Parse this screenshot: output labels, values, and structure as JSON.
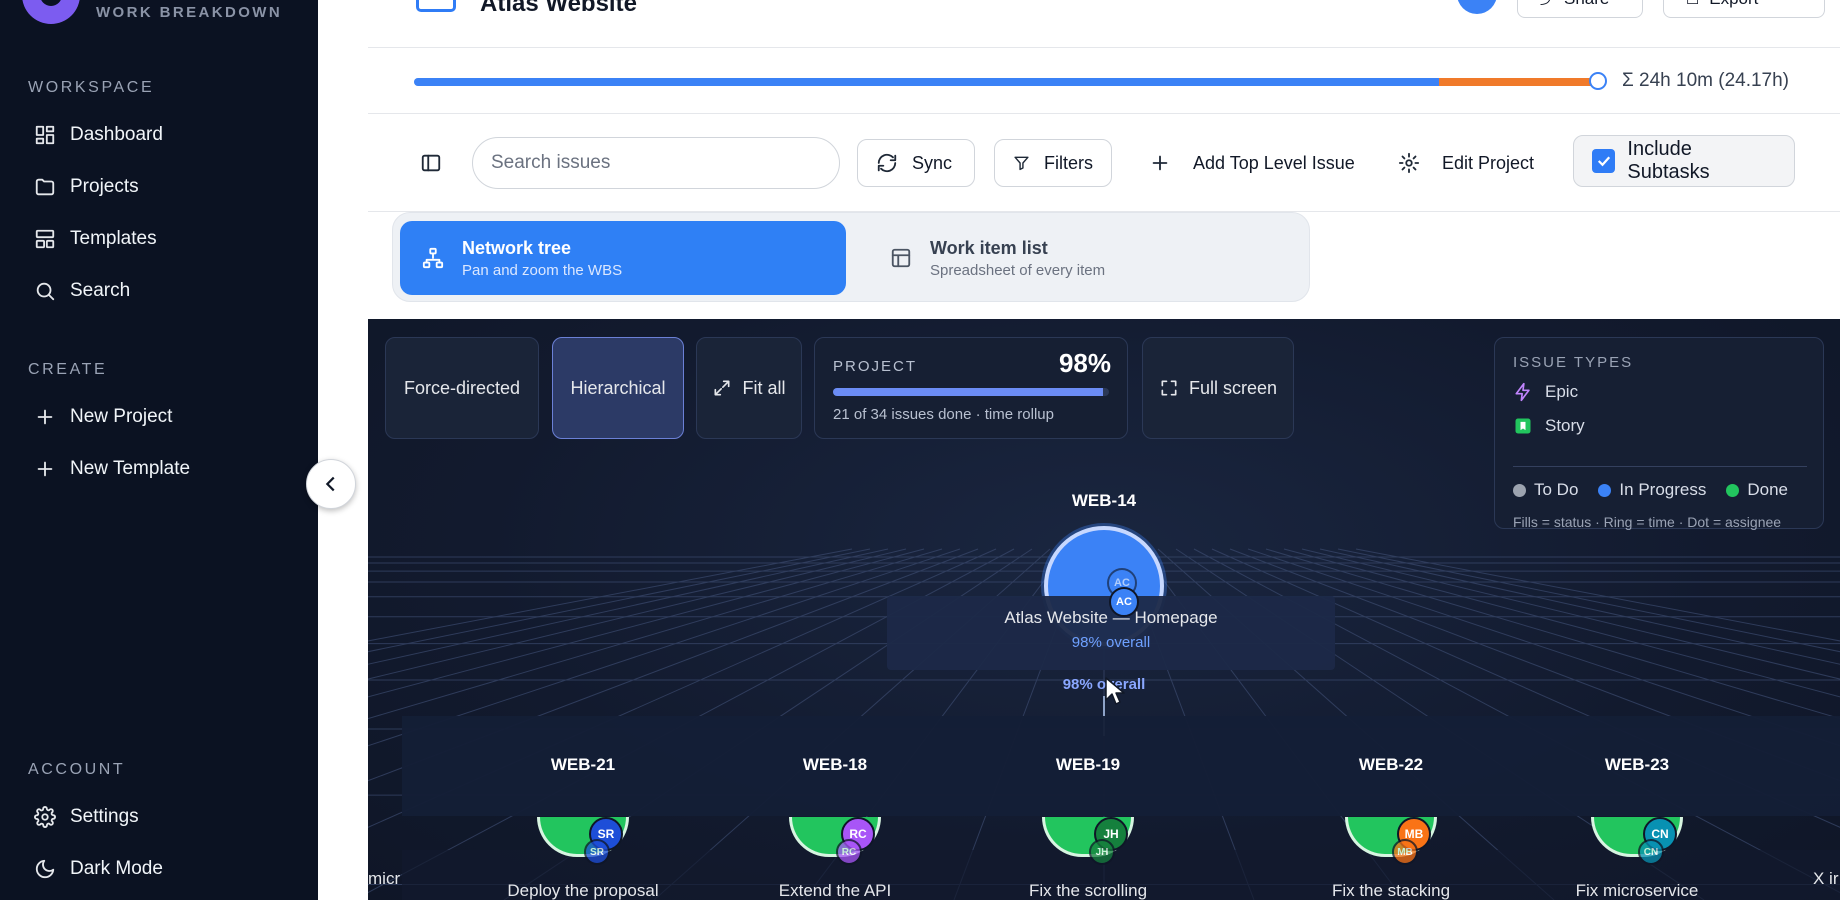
{
  "sidebar": {
    "brand_subtitle": "WORK BREAKDOWN",
    "workspace_label": "WORKSPACE",
    "workspace_items": [
      {
        "label": "Dashboard",
        "icon": "dashboard-icon"
      },
      {
        "label": "Projects",
        "icon": "folder-icon"
      },
      {
        "label": "Templates",
        "icon": "template-icon"
      },
      {
        "label": "Search",
        "icon": "search-icon"
      }
    ],
    "create_label": "CREATE",
    "create_items": [
      {
        "label": "New Project",
        "icon": "plus-icon"
      },
      {
        "label": "New Template",
        "icon": "plus-icon"
      }
    ],
    "account_label": "ACCOUNT",
    "account_items": [
      {
        "label": "Settings",
        "icon": "gear-icon"
      },
      {
        "label": "Dark Mode",
        "icon": "moon-icon"
      }
    ]
  },
  "header": {
    "project_title": "Atlas Website",
    "share_label": "Share",
    "export_label": "Export"
  },
  "progress": {
    "done_fraction": 0.866,
    "overrun_fraction": 0.134,
    "total_text": "Σ 24h 10m (24.17h)"
  },
  "toolbar": {
    "search_placeholder": "Search issues",
    "sync_label": "Sync",
    "filters_label": "Filters",
    "add_top_label": "Add Top Level Issue",
    "edit_project_label": "Edit Project",
    "include_subtasks_label": "Include Subtasks",
    "include_subtasks_checked": true
  },
  "views": {
    "network": {
      "title": "Network tree",
      "subtitle": "Pan and zoom the WBS"
    },
    "list": {
      "title": "Work item list",
      "subtitle": "Spreadsheet of every item"
    }
  },
  "canvas": {
    "layout_force": "Force-directed",
    "layout_hier": "Hierarchical",
    "fit_all": "Fit all",
    "full_screen": "Full screen",
    "project_card": {
      "label": "PROJECT",
      "percent": "98%",
      "percent_value": 0.98,
      "summary": "21 of 34 issues done · time rollup"
    },
    "legend": {
      "title": "ISSUE TYPES",
      "types": [
        {
          "label": "Epic",
          "color": "#c084fc"
        },
        {
          "label": "Story",
          "color": "#22c55e"
        }
      ],
      "statuses": [
        {
          "label": "To Do",
          "color": "#9ca3af"
        },
        {
          "label": "In Progress",
          "color": "#3b82f6"
        },
        {
          "label": "Done",
          "color": "#22c55e"
        }
      ],
      "hint": "Fills = status · Ring = time · Dot = assignee"
    },
    "root": {
      "id": "WEB-14",
      "assignee": "AC",
      "tooltip_title": "Atlas Website — Homepage",
      "tooltip_sub": "98% overall",
      "overall_text": "98% overall"
    },
    "children": [
      {
        "id": "WEB-21",
        "assignee": "SR",
        "assignee_color": "#1d4ed8",
        "label": "Deploy the proposal"
      },
      {
        "id": "WEB-18",
        "assignee": "RC",
        "assignee_color": "#a855f7",
        "label": "Extend the API"
      },
      {
        "id": "WEB-19",
        "assignee": "JH",
        "assignee_color": "#15803d",
        "label": "Fix the scrolling"
      },
      {
        "id": "WEB-22",
        "assignee": "MB",
        "assignee_color": "#f97316",
        "label": "Fix the stacking"
      },
      {
        "id": "WEB-23",
        "assignee": "CN",
        "assignee_color": "#0891b2",
        "label": "Fix microservice"
      }
    ],
    "edge_left_text": "micr",
    "edge_right_text": "X ir"
  }
}
